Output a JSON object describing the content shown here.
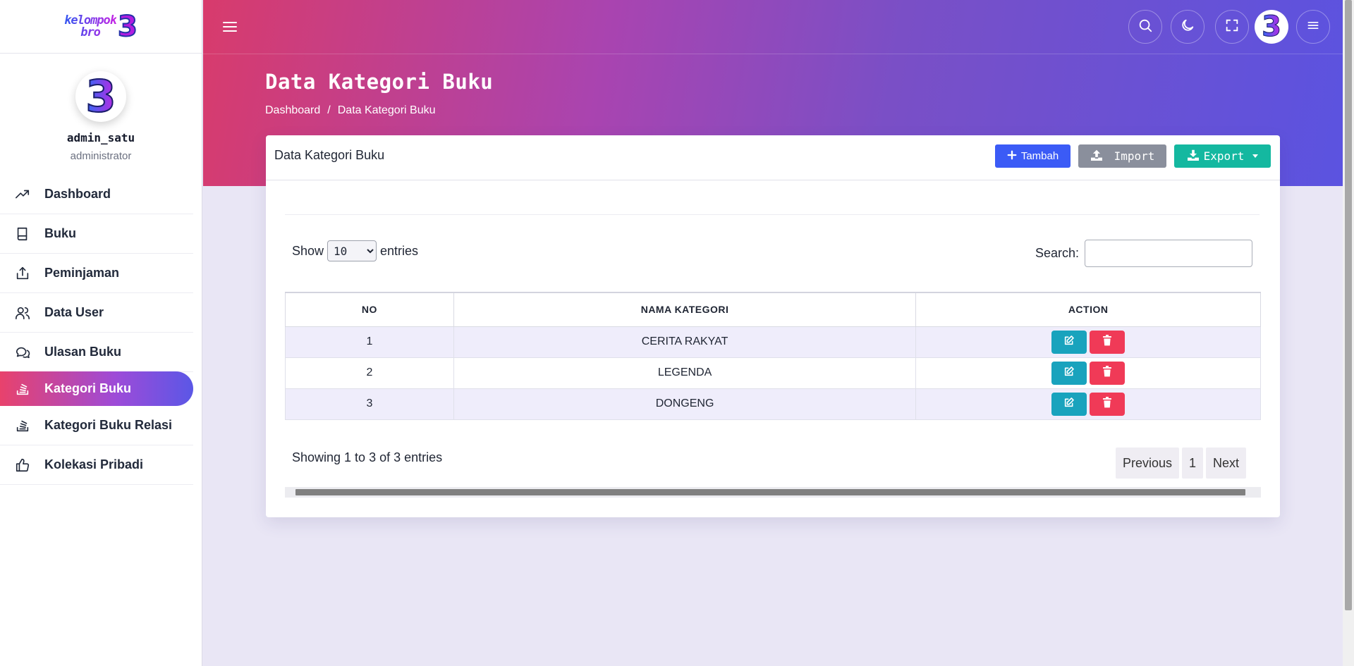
{
  "sidebar": {
    "logo_text_line1": "kelompok",
    "logo_text_line2": "bro",
    "logo_number": "3",
    "avatar_glyph": "3",
    "username": "admin_satu",
    "role": "administrator",
    "items": [
      {
        "label": "Dashboard",
        "icon": "trending-up-icon"
      },
      {
        "label": "Buku",
        "icon": "book-icon"
      },
      {
        "label": "Peminjaman",
        "icon": "upload-icon"
      },
      {
        "label": "Data User",
        "icon": "users-icon"
      },
      {
        "label": "Ulasan Buku",
        "icon": "chat-icon"
      },
      {
        "label": "Kategori Buku",
        "icon": "stack-icon"
      },
      {
        "label": "Kategori Buku Relasi",
        "icon": "stack-icon"
      },
      {
        "label": "Kolekasi Pribadi",
        "icon": "thumbs-up-icon"
      }
    ],
    "active_index": 5
  },
  "topbar": {
    "icons": [
      "menu-icon",
      "search-icon",
      "moon-icon",
      "fullscreen-icon",
      "user-avatar",
      "more-menu-icon"
    ],
    "avatar_glyph": "3"
  },
  "header": {
    "title": "Data Kategori Buku",
    "breadcrumb": {
      "home": "Dashboard",
      "separator": "/",
      "current": "Data Kategori Buku"
    }
  },
  "card": {
    "title": "Data Kategori Buku",
    "buttons": {
      "add": "Tambah",
      "import": "Import",
      "export": "Export"
    }
  },
  "table_controls": {
    "show_label": "Show",
    "entries_label": "entries",
    "page_length": "10",
    "search_label": "Search:",
    "search_value": ""
  },
  "table": {
    "columns": [
      "NO",
      "NAMA KATEGORI",
      "ACTION"
    ],
    "rows": [
      {
        "no": "1",
        "nama": "CERITA RAKYAT"
      },
      {
        "no": "2",
        "nama": "LEGENDA"
      },
      {
        "no": "3",
        "nama": "DONGENG"
      }
    ]
  },
  "footer": {
    "info": "Showing 1 to 3 of 3 entries",
    "pagination": {
      "previous": "Previous",
      "page": "1",
      "next": "Next"
    }
  },
  "colors": {
    "accent_gradient_start": "#d83b6c",
    "accent_gradient_end": "#5b53e0",
    "add_button": "#3b5bf6",
    "import_button": "#8a8f9c",
    "export_button": "#14b8a0",
    "edit_button": "#19a3bd",
    "delete_button": "#f03a57"
  }
}
